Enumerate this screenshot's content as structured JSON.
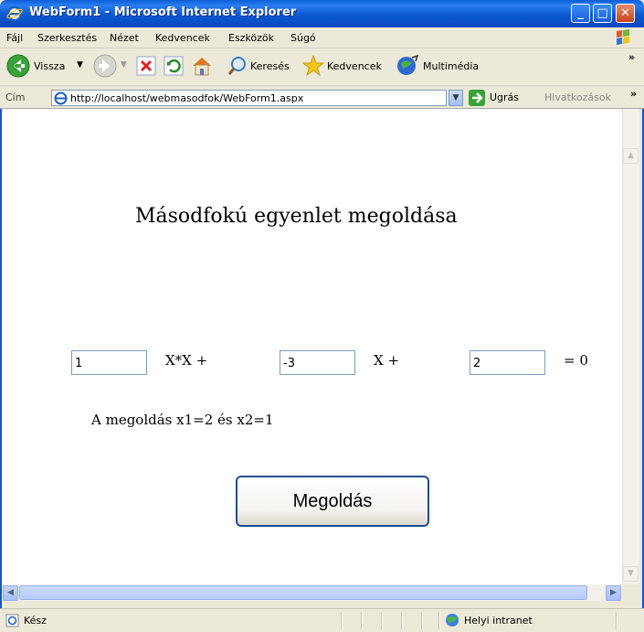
{
  "window": {
    "title": "WebForm1 - Microsoft Internet Explorer",
    "minimize": "_",
    "maximize": "□",
    "close": "✕"
  },
  "menu": {
    "items": [
      "Fájl",
      "Szerkesztés",
      "Nézet",
      "Kedvencek",
      "Eszközök",
      "Súgó"
    ]
  },
  "toolbar": {
    "back_label": "Vissza",
    "search_label": "Keresés",
    "favorites_label": "Kedvencek",
    "multimedia_label": "Multimédia",
    "overflow": "»"
  },
  "address": {
    "label": "Cím",
    "url": "http://localhost/webmasodfok/WebForm1.aspx",
    "go_label": "Ugrás",
    "links_label": "Hivatkozások",
    "overflow": "»"
  },
  "page": {
    "heading": "Másodfokú egyenlet megoldása",
    "a_value": "1",
    "x2_term": "X*X +",
    "b_value": "-3",
    "x_term": "X +",
    "c_value": "2",
    "eq_zero": "= 0",
    "result": "A megoldás x1=2 és x2=1",
    "solve_button": "Megoldás"
  },
  "status": {
    "text": "Kész",
    "zone": "Helyi intranet"
  },
  "colors": {
    "title_blue": "#0b58d0",
    "frame_bg": "#ece9d8",
    "button_border": "#1f4d93"
  }
}
